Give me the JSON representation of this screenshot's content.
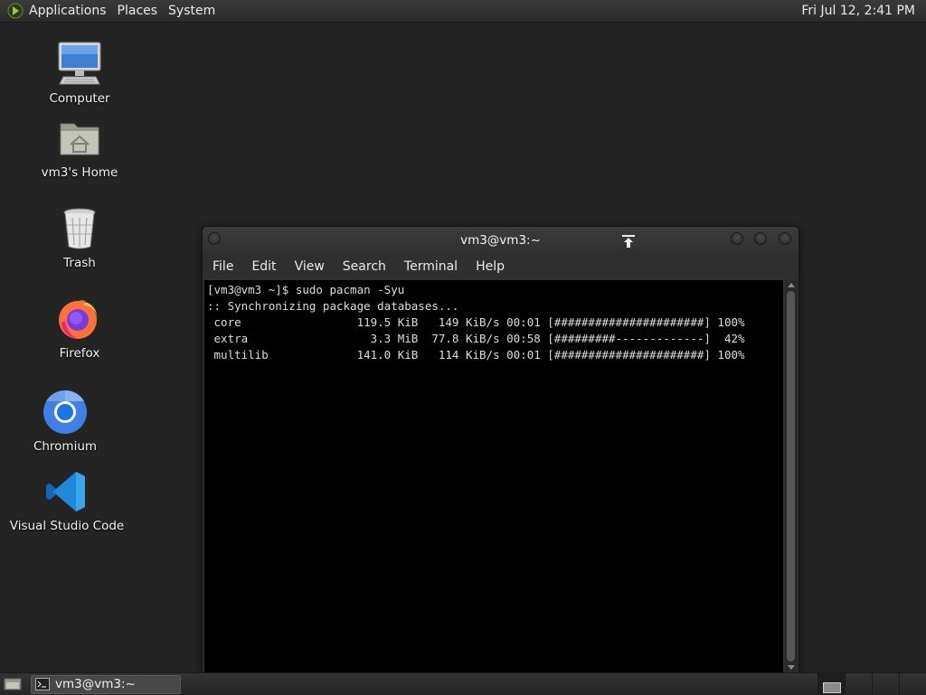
{
  "top_panel": {
    "menus": [
      "Applications",
      "Places",
      "System"
    ],
    "clock": "Fri Jul 12,  2:41 PM"
  },
  "desktop": {
    "icons": [
      {
        "label": "Computer",
        "icon": "computer-icon"
      },
      {
        "label": "vm3's Home",
        "icon": "home-folder-icon"
      },
      {
        "label": "Trash",
        "icon": "trash-icon"
      },
      {
        "label": "Firefox",
        "icon": "firefox-icon"
      },
      {
        "label": "Chromium",
        "icon": "chromium-icon"
      },
      {
        "label": "Visual Studio Code",
        "icon": "vscode-icon"
      }
    ]
  },
  "terminal": {
    "title": "vm3@vm3:~",
    "menus": [
      "File",
      "Edit",
      "View",
      "Search",
      "Terminal",
      "Help"
    ],
    "lines": [
      "[vm3@vm3 ~]$ sudo pacman -Syu",
      ":: Synchronizing package databases...",
      " core                 119.5 KiB   149 KiB/s 00:01 [######################] 100%",
      " extra                  3.3 MiB  77.8 KiB/s 00:58 [#########-------------]  42%",
      " multilib             141.0 KiB   114 KiB/s 00:01 [######################] 100%"
    ]
  },
  "bottom_panel": {
    "task_label": "vm3@vm3:~"
  },
  "colors": {
    "desktop_bg": "#242424",
    "terminal_bg": "#000000",
    "panel_bg": "#2b2b2b"
  }
}
